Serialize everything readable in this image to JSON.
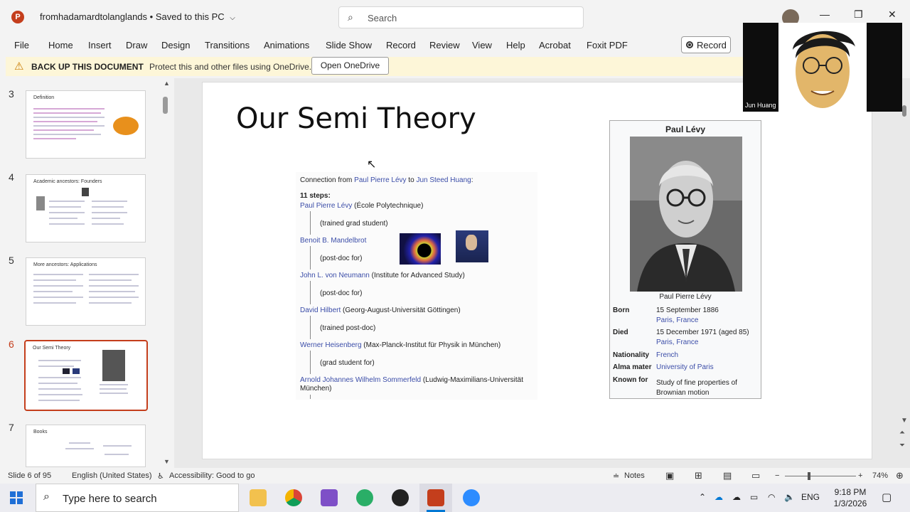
{
  "window": {
    "file_name": "fromhadamardtolanglands",
    "save_status": "Saved to this PC",
    "search_placeholder": "Search",
    "minimize": "—",
    "restore": "❐",
    "close": "✕"
  },
  "ribbon": {
    "tabs": [
      "File",
      "Home",
      "Insert",
      "Draw",
      "Design",
      "Transitions",
      "Animations",
      "Slide Show",
      "Record",
      "Review",
      "View",
      "Help",
      "Acrobat",
      "Foxit PDF"
    ],
    "record_button": "Record"
  },
  "message_bar": {
    "title": "BACK UP THIS DOCUMENT",
    "text": "Protect this and other files using OneDrive.",
    "button": "Open OneDrive"
  },
  "thumbnails": [
    {
      "number": "3",
      "title": "Definition"
    },
    {
      "number": "4",
      "title": "Academic ancestors: Founders"
    },
    {
      "number": "5",
      "title": "More ancestors: Applications"
    },
    {
      "number": "6",
      "title": "Our Semi Theory",
      "active": true
    },
    {
      "number": "7",
      "title": "Books"
    }
  ],
  "slide": {
    "title": "Our Semi Theory",
    "connection_heading_prefix": "Connection from ",
    "connection_from": "Paul Pierre Lévy",
    "connection_mid": " to ",
    "connection_to": "Jun Steed Huang",
    "connection_suffix": ":",
    "steps": "11 steps:",
    "chain": [
      {
        "name": "Paul Pierre Lévy",
        "inst": " (École Polytechnique)"
      },
      {
        "role": "(trained grad student)"
      },
      {
        "name": "Benoit B. Mandelbrot",
        "inst": ""
      },
      {
        "role": "(post-doc for)"
      },
      {
        "name": "John L. von Neumann",
        "inst": " (Institute for Advanced Study)"
      },
      {
        "role": "(post-doc for)"
      },
      {
        "name": "David Hilbert",
        "inst": " (Georg-August-Universität Göttingen)"
      },
      {
        "role": "(trained post-doc)"
      },
      {
        "name": "Werner Heisenberg",
        "inst": " (Max-Planck-Institut für Physik in München)"
      },
      {
        "role": "(grad student for)"
      },
      {
        "name": "Arnold Johannes Wilhelm Sommerfeld",
        "inst": " (Ludwig-Maximilians-Universität München)"
      }
    ],
    "infobox": {
      "name": "Paul Lévy",
      "caption": "Paul Pierre Lévy",
      "born_label": "Born",
      "born_date": "15 September 1886",
      "born_place": "Paris, France",
      "died_label": "Died",
      "died_date": "15 December 1971 (aged 85)",
      "died_place": "Paris, France",
      "nationality_label": "Nationality",
      "nationality": "French",
      "alma_label": "Alma mater",
      "alma": "University of Paris",
      "known_label": "Known for",
      "known_1": "Study of fine properties of",
      "known_2": "Brownian motion"
    }
  },
  "video": {
    "participant": "Jun Huang"
  },
  "status": {
    "slide_info": "Slide 6 of 95",
    "language": "English (United States)",
    "accessibility": "Accessibility: Good to go",
    "notes": "Notes",
    "zoom_minus": "−",
    "zoom_plus": "+",
    "zoom": "74%"
  },
  "taskbar": {
    "search_placeholder": "Type here to search",
    "language": "ENG",
    "time": "9:18 PM",
    "date": "1/3/2026"
  },
  "colors": {
    "accent": "#c43e1c",
    "link": "#3b4da8",
    "windows_blue": "#0078d4"
  }
}
